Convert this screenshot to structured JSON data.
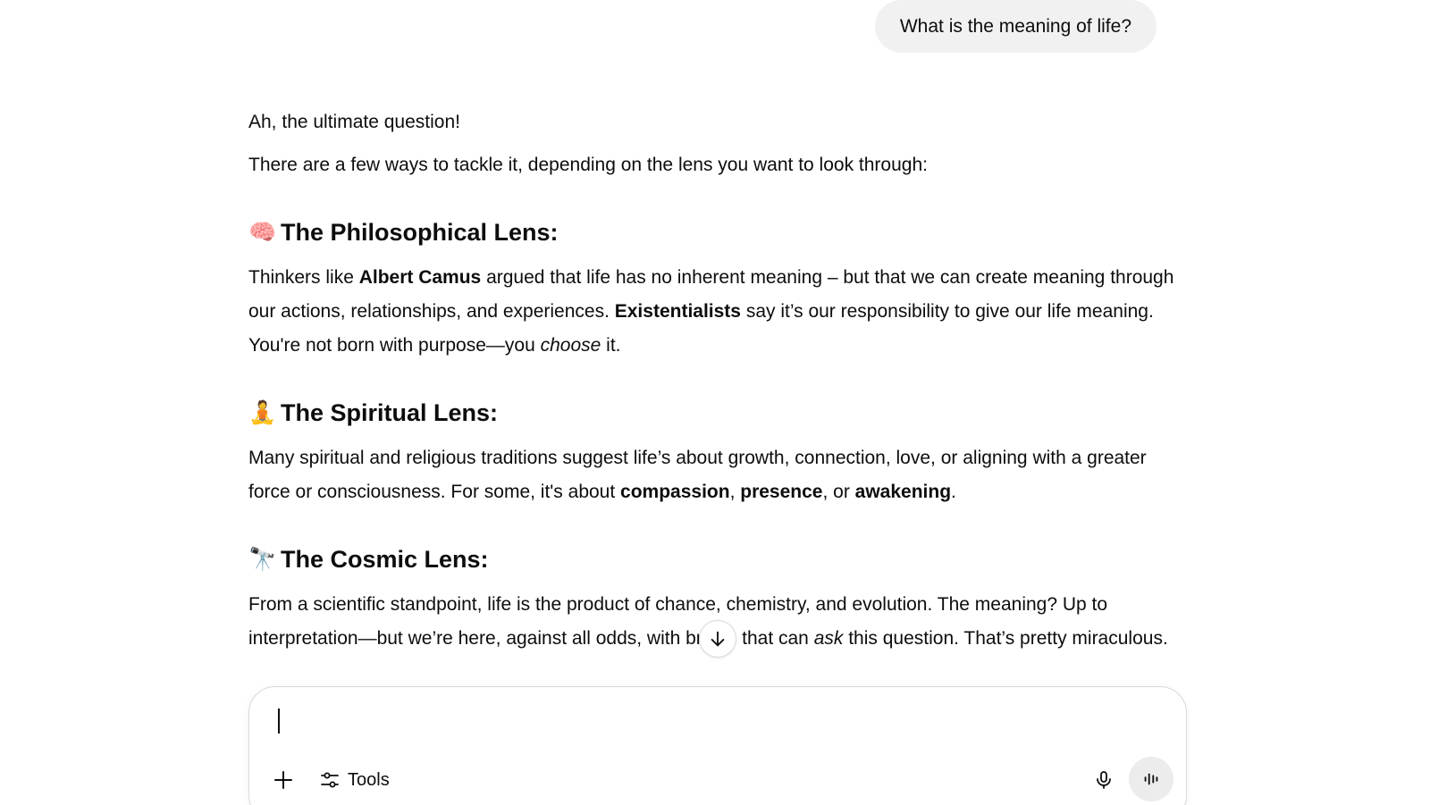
{
  "user_message": "What is the meaning of life?",
  "assistant": {
    "intro1": "Ah, the ultimate question!",
    "intro2": "There are a few ways to tackle it, depending on the lens you want to look through:",
    "sections": [
      {
        "emoji": "🧠",
        "heading": "The Philosophical Lens:",
        "t1": "Thinkers like ",
        "b1": "Albert Camus",
        "t2": " argued that life has no inherent meaning – but that we can create meaning through our actions, relationships, and experiences. ",
        "b2": "Existentialists",
        "t3": " say it’s our responsibility to give our life meaning. You're not born with purpose—you ",
        "i1": "choose",
        "t4": " it."
      },
      {
        "emoji": "🧘",
        "heading": "The Spiritual Lens:",
        "t1": "Many spiritual and religious traditions suggest life’s about growth, connection, love, or aligning with a greater force or consciousness. For some, it's about ",
        "b1": "compassion",
        "t2": ", ",
        "b2": "presence",
        "t3": ", or ",
        "b3": "awakening",
        "t4": "."
      },
      {
        "emoji": "🔭",
        "heading": "The Cosmic Lens:",
        "t1": "From a scientific standpoint, life is the product of chance, chemistry, and evolution. The meaning? Up to interpretation—but we’re here, against all odds, with brains that can ",
        "i1": "ask",
        "t2": " this question. That’s pretty miraculous."
      }
    ]
  },
  "composer": {
    "input_value": "",
    "tools_label": "Tools"
  },
  "icons": {
    "scroll_down": "arrow-down-icon",
    "plus": "plus-icon",
    "tools": "sliders-icon",
    "mic": "microphone-icon",
    "voice": "voice-waveform-icon"
  }
}
